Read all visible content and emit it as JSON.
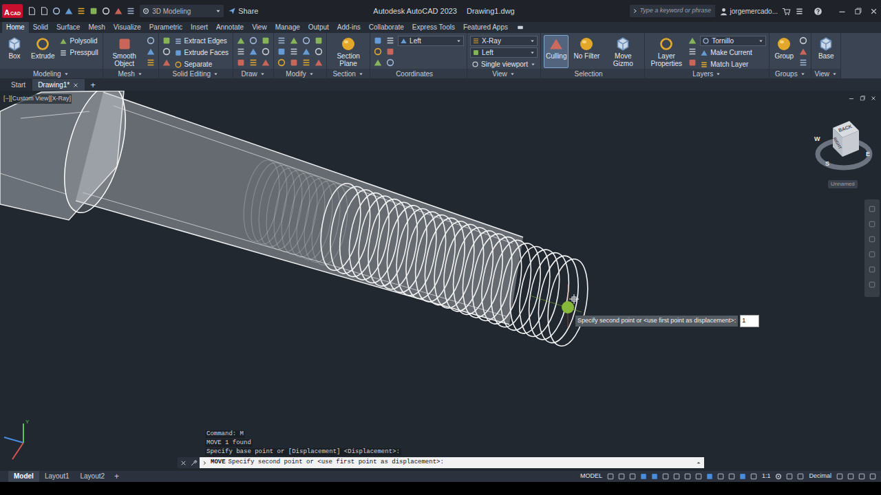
{
  "title_bar": {
    "logo": "A",
    "logo_sub": "CAD",
    "workspace": "3D Modeling",
    "share": "Share",
    "app_title": "Autodesk AutoCAD 2023",
    "file_name": "Drawing1.dwg",
    "search": {
      "placeholder": "Type a keyword or phrase"
    },
    "user": "jorgemercado..."
  },
  "ribbon_tabs": [
    {
      "label": "Home",
      "selected": true
    },
    {
      "label": "Solid",
      "selected": false
    },
    {
      "label": "Surface",
      "selected": false
    },
    {
      "label": "Mesh",
      "selected": false
    },
    {
      "label": "Visualize",
      "selected": false
    },
    {
      "label": "Parametric",
      "selected": false
    },
    {
      "label": "Insert",
      "selected": false
    },
    {
      "label": "Annotate",
      "selected": false
    },
    {
      "label": "View",
      "selected": false
    },
    {
      "label": "Manage",
      "selected": false
    },
    {
      "label": "Output",
      "selected": false
    },
    {
      "label": "Add-ins",
      "selected": false
    },
    {
      "label": "Collaborate",
      "selected": false
    },
    {
      "label": "Express Tools",
      "selected": false
    },
    {
      "label": "Featured Apps",
      "selected": false
    }
  ],
  "ribbon_panels": [
    {
      "title": "Modeling",
      "dropdown": true,
      "items": [
        {
          "kind": "large",
          "label": "Box",
          "selected": false
        },
        {
          "kind": "large",
          "label": "Extrude",
          "selected": false
        },
        {
          "kind": "small",
          "label": "Polysolid"
        },
        {
          "kind": "small",
          "label": "Presspull"
        }
      ]
    },
    {
      "title": "Mesh",
      "dropdown": true,
      "items": [
        {
          "kind": "large",
          "label": "Smooth Object",
          "selected": false
        },
        {
          "kind": "icons"
        }
      ]
    },
    {
      "title": "Solid Editing",
      "dropdown": true,
      "items": [
        {
          "kind": "icons"
        },
        {
          "kind": "small",
          "label": "Extract Edges"
        },
        {
          "kind": "small",
          "label": "Extrude Faces"
        },
        {
          "kind": "small",
          "label": "Separate"
        }
      ]
    },
    {
      "title": "Draw",
      "dropdown": true,
      "items": [
        {
          "kind": "icons"
        },
        {
          "kind": "icons"
        },
        {
          "kind": "icons"
        }
      ]
    },
    {
      "title": "Modify",
      "dropdown": true,
      "items": [
        {
          "kind": "icons"
        },
        {
          "kind": "icons"
        },
        {
          "kind": "icons"
        },
        {
          "kind": "icons"
        }
      ]
    },
    {
      "title": "Section",
      "dropdown": true,
      "items": [
        {
          "kind": "large",
          "label": "Section Plane",
          "selected": false
        }
      ]
    },
    {
      "title": "Coordinates",
      "dropdown": false,
      "items": [
        {
          "kind": "icons"
        },
        {
          "kind": "icons"
        },
        {
          "kind": "dropdown",
          "label": "Left"
        }
      ]
    },
    {
      "title": "View",
      "dropdown": true,
      "items": [
        {
          "kind": "dropdown",
          "label": "X-Ray"
        },
        {
          "kind": "dropdown",
          "label": "Left"
        },
        {
          "kind": "menu",
          "label": "Single viewport"
        }
      ]
    },
    {
      "title": "Selection",
      "dropdown": false,
      "items": [
        {
          "kind": "large",
          "label": "Culling",
          "selected": true
        },
        {
          "kind": "large",
          "label": "No Filter",
          "selected": false
        },
        {
          "kind": "large",
          "label": "Move Gizmo",
          "selected": false
        }
      ]
    },
    {
      "title": "Layers",
      "dropdown": true,
      "items": [
        {
          "kind": "large",
          "label": "Layer Properties",
          "selected": false
        },
        {
          "kind": "icons"
        },
        {
          "kind": "dropdown",
          "label": "Tornillo"
        },
        {
          "kind": "small",
          "label": "Make Current"
        },
        {
          "kind": "small",
          "label": "Match Layer"
        }
      ]
    },
    {
      "title": "Groups",
      "dropdown": true,
      "items": [
        {
          "kind": "large",
          "label": "Group",
          "selected": false
        },
        {
          "kind": "icons"
        }
      ]
    },
    {
      "title": "View",
      "dropdown": true,
      "items": [
        {
          "kind": "large",
          "label": "Base",
          "selected": false
        }
      ]
    }
  ],
  "file_tabs": [
    {
      "label": "Start",
      "selected": false
    },
    {
      "label": "Drawing1*",
      "selected": true
    }
  ],
  "new_tab": "+",
  "viewport": {
    "label": "[−][Custom View][X-Ray]"
  },
  "viewcube": {
    "top": "BACK",
    "face": "RIGHT",
    "compass": [
      "W",
      "S",
      "E"
    ],
    "ucs_name": "Unnamed"
  },
  "ucs_icon": {
    "y_label": "Y"
  },
  "dynamic_input": {
    "prompt": "Specify second point or <use first point as displacement>:",
    "value": "1"
  },
  "command_line": {
    "history": [
      "Command: M",
      "MOVE 1 found",
      "Specify base point or [Displacement] <Displacement>:"
    ],
    "command": "MOVE",
    "prompt": "Specify second point or <use first point as displacement>:"
  },
  "status_bar": {
    "layouts": [
      {
        "label": "Model",
        "selected": true
      },
      {
        "label": "Layout1",
        "selected": false
      },
      {
        "label": "Layout2",
        "selected": false
      }
    ],
    "add": "+",
    "space": "MODEL",
    "scale": "1:1",
    "units": "Decimal"
  }
}
